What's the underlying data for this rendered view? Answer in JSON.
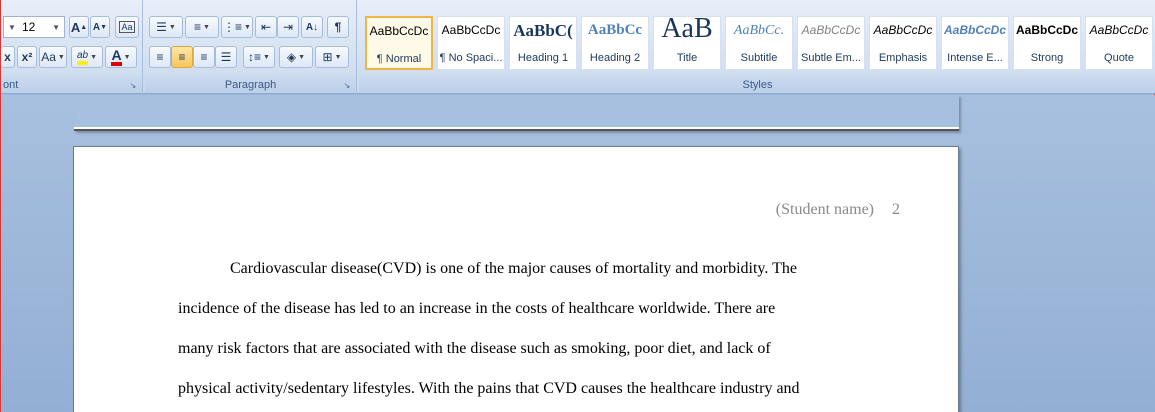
{
  "font_group": {
    "font_size": "12",
    "label": "ont",
    "grow_label": "A",
    "shrink_label": "A",
    "clear_label": "Aa",
    "subscript_label": "x",
    "superscript_label": "x²",
    "change_case_label": "Aa",
    "highlight_label": "ab",
    "font_color_label": "A"
  },
  "paragraph_group": {
    "label": "Paragraph",
    "sort_label": "A↓",
    "pilcrow_label": "¶"
  },
  "styles_group": {
    "label": "Styles",
    "items": [
      {
        "sample": "AaBbCcDc",
        "name": "¶ Normal"
      },
      {
        "sample": "AaBbCcDc",
        "name": "¶ No Spaci..."
      },
      {
        "sample": "AaBbC(",
        "name": "Heading 1"
      },
      {
        "sample": "AaBbCc",
        "name": "Heading 2"
      },
      {
        "sample": "AaB",
        "name": "Title"
      },
      {
        "sample": "AaBbCc.",
        "name": "Subtitle"
      },
      {
        "sample": "AaBbCcDc",
        "name": "Subtle Em..."
      },
      {
        "sample": "AaBbCcDc",
        "name": "Emphasis"
      },
      {
        "sample": "AaBbCcDc",
        "name": "Intense E..."
      },
      {
        "sample": "AaBbCcDc",
        "name": "Strong"
      },
      {
        "sample": "AaBbCcDc",
        "name": "Quote"
      }
    ]
  },
  "document": {
    "header_name": "(Student name)",
    "page_number": "2",
    "lines": [
      "Cardiovascular disease(CVD) is one of the major causes of mortality and morbidity. The",
      "incidence of the disease has led to an increase in the costs of healthcare worldwide. There are",
      "many risk factors that are associated with the disease such as smoking, poor diet, and lack of",
      "physical activity/sedentary lifestyles. With the pains that CVD  causes the healthcare industry and"
    ]
  }
}
